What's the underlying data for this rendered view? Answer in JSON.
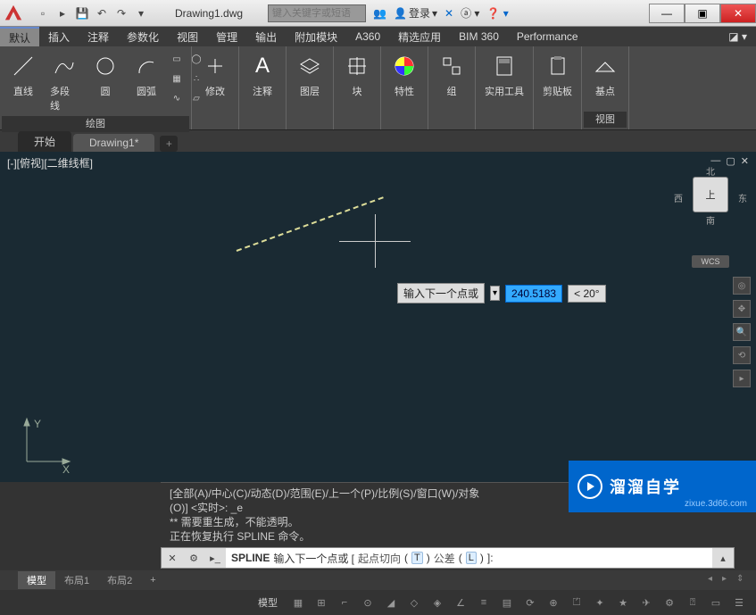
{
  "title": "Drawing1.dwg",
  "search_placeholder": "键入关键字或短语",
  "login_label": "登录",
  "menus": [
    "默认",
    "插入",
    "注释",
    "参数化",
    "视图",
    "管理",
    "输出",
    "附加模块",
    "A360",
    "精选应用",
    "BIM 360",
    "Performance"
  ],
  "ribbon": {
    "draw_panel": "绘图",
    "line": "直线",
    "polyline": "多段线",
    "circle": "圆",
    "arc": "圆弧",
    "modify": "修改",
    "annotate": "注释",
    "layer": "图层",
    "block": "块",
    "properties": "特性",
    "group": "组",
    "utilities": "实用工具",
    "clipboard": "剪贴板",
    "base": "基点",
    "view_panel": "视图"
  },
  "tabs": {
    "start": "开始",
    "drawing": "Drawing1*"
  },
  "viewport": {
    "label": "[-][俯视][二维线框]"
  },
  "navcube": {
    "face": "上",
    "n": "北",
    "s": "南",
    "e": "东",
    "w": "西",
    "wcs": "WCS"
  },
  "ucs": {
    "x": "X",
    "y": "Y"
  },
  "dynamic_input": {
    "prompt": "输入下一个点或",
    "value": "240.5183",
    "angle": "< 20°"
  },
  "cmd_history": {
    "l1": "[全部(A)/中心(C)/动态(D)/范围(E)/上一个(P)/比例(S)/窗口(W)/对象",
    "l2": "(O)] <实时>: _e",
    "l3": "** 需要重生成，不能透明。",
    "l4": "正在恢复执行 SPLINE 命令。"
  },
  "cmdline": {
    "cmd": "SPLINE",
    "prompt": "输入下一个点或 [",
    "opt1": "起点切向",
    "k1": "T",
    "opt2": " 公差",
    "k2": "L",
    "suffix": "]:"
  },
  "layouts": {
    "model": "模型",
    "l1": "布局1",
    "l2": "布局2",
    "add": "+"
  },
  "status_model": "模型",
  "watermark": {
    "text": "溜溜自学",
    "url": "zixue.3d66.com"
  }
}
